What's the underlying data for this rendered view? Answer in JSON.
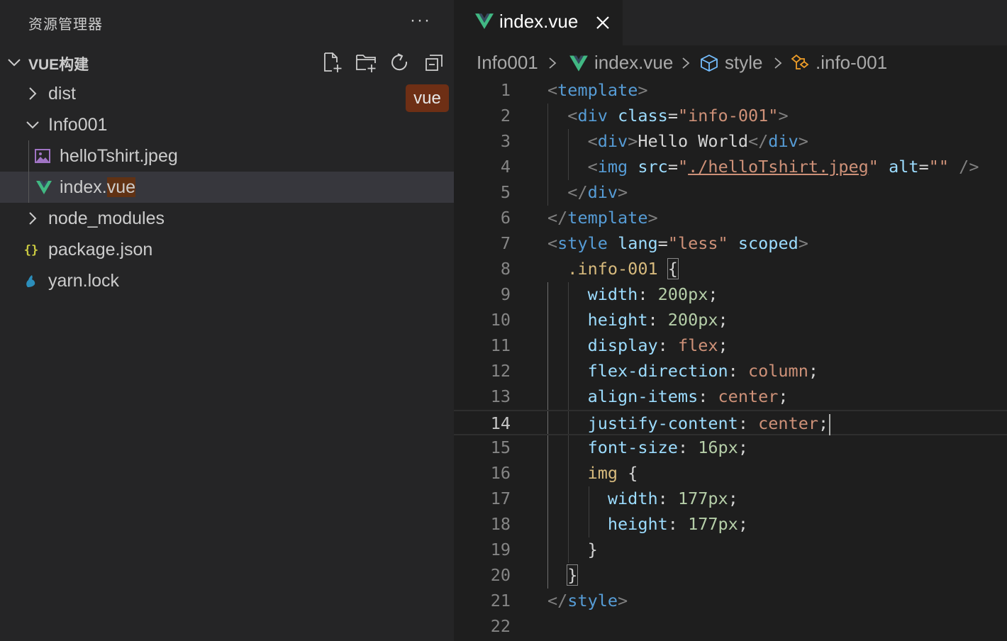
{
  "sidebar": {
    "title": "资源管理器",
    "more": "···",
    "project": "VUE构建",
    "tooltip": "vue",
    "items": [
      {
        "label": "dist",
        "icon": "chevron-right-icon"
      },
      {
        "label": "Info001",
        "icon": "chevron-down-icon"
      },
      {
        "label": "helloTshirt.jpeg",
        "icon": "image-file-icon"
      },
      {
        "label_a": "index.",
        "label_b": "vue",
        "icon": "vue-file-icon",
        "selected": true
      },
      {
        "label": "node_modules",
        "icon": "chevron-right-icon"
      },
      {
        "label": "package.json",
        "icon": "json-file-icon"
      },
      {
        "label": "yarn.lock",
        "icon": "yarn-file-icon"
      }
    ]
  },
  "tab": {
    "label": "index.vue"
  },
  "breadcrumb": [
    "Info001",
    "index.vue",
    "style",
    ".info-001"
  ],
  "editor": {
    "current_line": 14,
    "lines": [
      [
        [
          "c-br",
          "<"
        ],
        [
          "c-tag",
          "template"
        ],
        [
          "c-br",
          ">"
        ]
      ],
      [
        [
          "c-txt",
          "  "
        ],
        [
          "c-br",
          "<"
        ],
        [
          "c-tag",
          "div"
        ],
        [
          "c-txt",
          " "
        ],
        [
          "c-attr",
          "class"
        ],
        [
          "c-txt",
          "="
        ],
        [
          "c-str",
          "\"info-001\""
        ],
        [
          "c-br",
          ">"
        ]
      ],
      [
        [
          "c-txt",
          "    "
        ],
        [
          "c-br",
          "<"
        ],
        [
          "c-tag",
          "div"
        ],
        [
          "c-br",
          ">"
        ],
        [
          "c-txt",
          "Hello World"
        ],
        [
          "c-br",
          "</"
        ],
        [
          "c-tag",
          "div"
        ],
        [
          "c-br",
          ">"
        ]
      ],
      [
        [
          "c-txt",
          "    "
        ],
        [
          "c-br",
          "<"
        ],
        [
          "c-tag",
          "img"
        ],
        [
          "c-txt",
          " "
        ],
        [
          "c-attr",
          "src"
        ],
        [
          "c-txt",
          "="
        ],
        [
          "c-str",
          "\""
        ],
        [
          "c-link",
          "./helloTshirt.jpeg"
        ],
        [
          "c-str",
          "\""
        ],
        [
          "c-txt",
          " "
        ],
        [
          "c-attr",
          "alt"
        ],
        [
          "c-txt",
          "="
        ],
        [
          "c-str",
          "\"\""
        ],
        [
          "c-txt",
          " "
        ],
        [
          "c-br",
          "/>"
        ]
      ],
      [
        [
          "c-txt",
          "  "
        ],
        [
          "c-br",
          "</"
        ],
        [
          "c-tag",
          "div"
        ],
        [
          "c-br",
          ">"
        ]
      ],
      [
        [
          "c-br",
          "</"
        ],
        [
          "c-tag",
          "template"
        ],
        [
          "c-br",
          ">"
        ]
      ],
      [
        [
          "c-br",
          "<"
        ],
        [
          "c-tag",
          "style"
        ],
        [
          "c-txt",
          " "
        ],
        [
          "c-attr",
          "lang"
        ],
        [
          "c-txt",
          "="
        ],
        [
          "c-str",
          "\"less\""
        ],
        [
          "c-txt",
          " "
        ],
        [
          "c-attr",
          "scoped"
        ],
        [
          "c-br",
          ">"
        ]
      ],
      [
        [
          "c-txt",
          "  "
        ],
        [
          "c-sel",
          ".info-001"
        ],
        [
          "c-txt",
          " "
        ],
        [
          "c-txt bracket-match",
          "{"
        ]
      ],
      [
        [
          "c-txt",
          "    "
        ],
        [
          "c-prop",
          "width"
        ],
        [
          "c-txt",
          ": "
        ],
        [
          "c-num",
          "200px"
        ],
        [
          "c-txt",
          ";"
        ]
      ],
      [
        [
          "c-txt",
          "    "
        ],
        [
          "c-prop",
          "height"
        ],
        [
          "c-txt",
          ": "
        ],
        [
          "c-num",
          "200px"
        ],
        [
          "c-txt",
          ";"
        ]
      ],
      [
        [
          "c-txt",
          "    "
        ],
        [
          "c-prop",
          "display"
        ],
        [
          "c-txt",
          ": "
        ],
        [
          "c-val",
          "flex"
        ],
        [
          "c-txt",
          ";"
        ]
      ],
      [
        [
          "c-txt",
          "    "
        ],
        [
          "c-prop",
          "flex-direction"
        ],
        [
          "c-txt",
          ": "
        ],
        [
          "c-val",
          "column"
        ],
        [
          "c-txt",
          ";"
        ]
      ],
      [
        [
          "c-txt",
          "    "
        ],
        [
          "c-prop",
          "align-items"
        ],
        [
          "c-txt",
          ": "
        ],
        [
          "c-val",
          "center"
        ],
        [
          "c-txt",
          ";"
        ]
      ],
      [
        [
          "c-txt",
          "    "
        ],
        [
          "c-prop",
          "justify-content"
        ],
        [
          "c-txt",
          ": "
        ],
        [
          "c-val",
          "center"
        ],
        [
          "c-txt",
          ";"
        ]
      ],
      [
        [
          "c-txt",
          "    "
        ],
        [
          "c-prop",
          "font-size"
        ],
        [
          "c-txt",
          ": "
        ],
        [
          "c-num",
          "16px"
        ],
        [
          "c-txt",
          ";"
        ]
      ],
      [
        [
          "c-txt",
          "    "
        ],
        [
          "c-sel",
          "img"
        ],
        [
          "c-txt",
          " {"
        ]
      ],
      [
        [
          "c-txt",
          "      "
        ],
        [
          "c-prop",
          "width"
        ],
        [
          "c-txt",
          ": "
        ],
        [
          "c-num",
          "177px"
        ],
        [
          "c-txt",
          ";"
        ]
      ],
      [
        [
          "c-txt",
          "      "
        ],
        [
          "c-prop",
          "height"
        ],
        [
          "c-txt",
          ": "
        ],
        [
          "c-num",
          "177px"
        ],
        [
          "c-txt",
          ";"
        ]
      ],
      [
        [
          "c-txt",
          "    }"
        ]
      ],
      [
        [
          "c-txt",
          "  "
        ],
        [
          "c-txt bracket-match",
          "}"
        ]
      ],
      [
        [
          "c-br",
          "</"
        ],
        [
          "c-tag",
          "style"
        ],
        [
          "c-br",
          ">"
        ]
      ],
      []
    ]
  }
}
